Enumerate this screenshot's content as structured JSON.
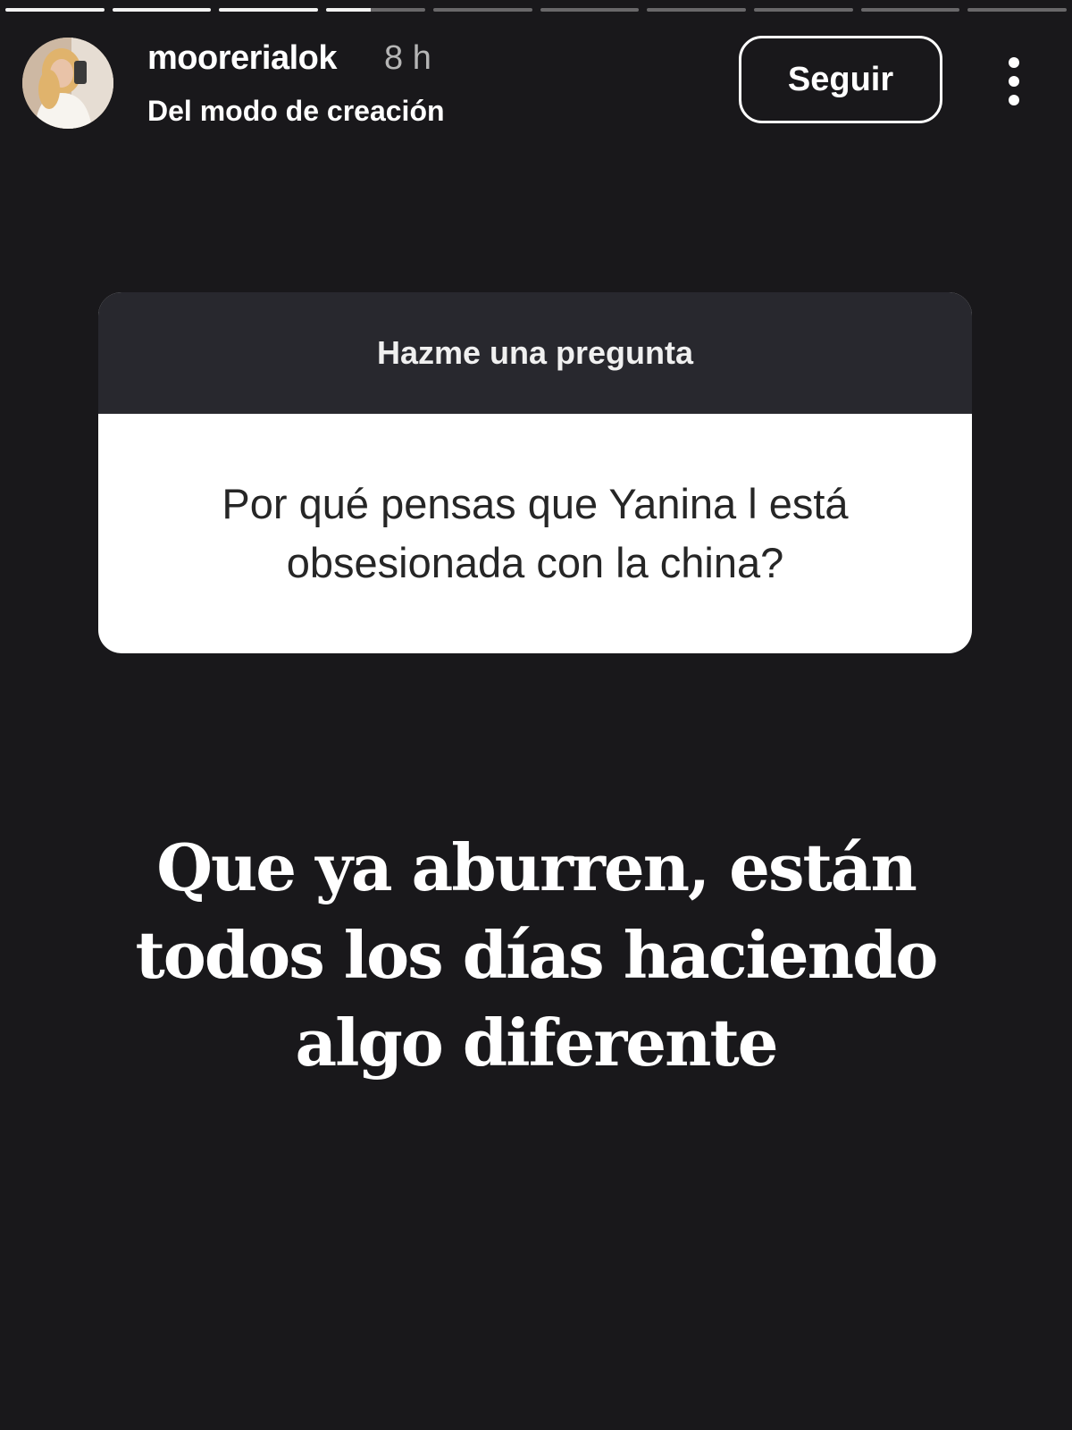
{
  "story": {
    "progress": {
      "segments": [
        1,
        1,
        1,
        0.45,
        0,
        0,
        0,
        0,
        0,
        0
      ]
    }
  },
  "header": {
    "avatar_icon": "profile-photo",
    "username": "moorerialok",
    "time": "8 h",
    "subtitle": "Del modo de creación",
    "follow_label": "Seguir",
    "more_icon": "vertical-ellipsis-icon"
  },
  "question": {
    "prompt": "Hazme una pregunta",
    "text": "Por qué pensas que Yanina l está obsesionada con la china?"
  },
  "answer": {
    "line1": "Que ya aburren, están",
    "line2": "todos los días haciendo",
    "line3": "algo diferente"
  },
  "colors": {
    "background": "#19181b",
    "sticker_header": "#28282e",
    "sticker_body": "#ffffff"
  }
}
